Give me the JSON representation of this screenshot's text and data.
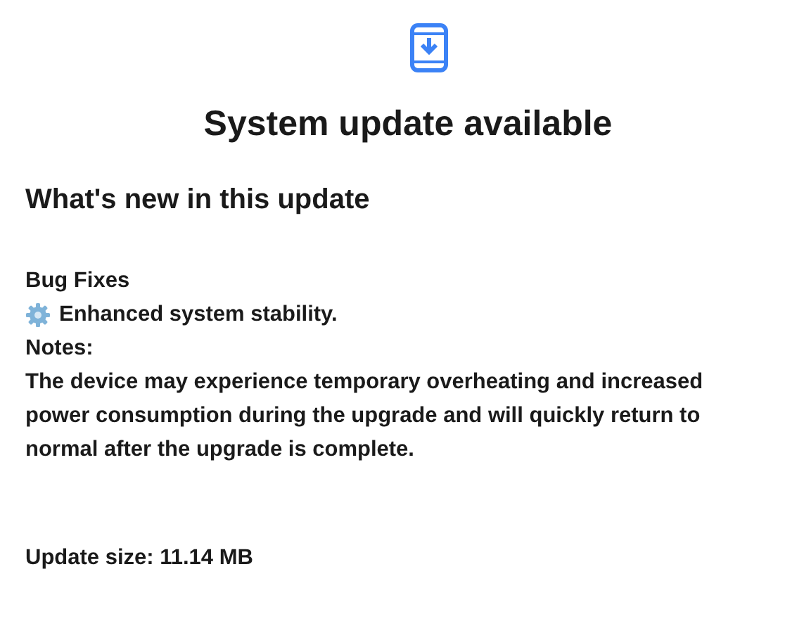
{
  "title": "System update available",
  "heading": "What's new in this update",
  "sections": [
    {
      "kind": "heading",
      "text": "Bug Fixes"
    },
    {
      "kind": "item",
      "text": "Enhanced system stability."
    },
    {
      "kind": "heading",
      "text": "Notes:"
    },
    {
      "kind": "paragraph",
      "text": "The device may experience temporary overheating and increased power consumption during the upgrade and will quickly return to normal after the upgrade is complete."
    }
  ],
  "update_size": "Update size: 11.14 MB"
}
